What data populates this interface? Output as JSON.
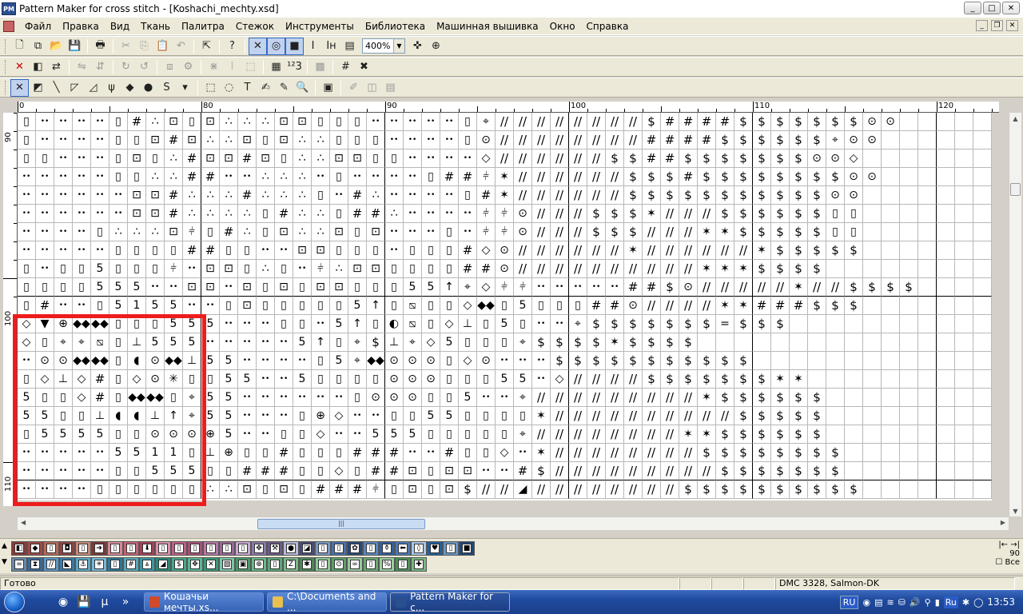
{
  "window": {
    "title": "Pattern Maker for cross stitch - [Koshachi_mechty.xsd]",
    "app_icon": "PM",
    "controls": [
      "_",
      "□",
      "✕"
    ]
  },
  "menu": [
    "Файл",
    "Правка",
    "Вид",
    "Ткань",
    "Палитра",
    "Стежок",
    "Инструменты",
    "Библиотека",
    "Машинная вышивка",
    "Окно",
    "Справка"
  ],
  "mdi_controls": [
    "_",
    "❐",
    "✕"
  ],
  "toolbars": {
    "row1": [
      "new-icon",
      "copy-doc-icon",
      "open-icon",
      "save-icon",
      "|",
      "print-icon",
      "|",
      "cut-icon",
      "copy-icon",
      "paste-icon",
      "undo-icon",
      "|",
      "import-icon",
      "|",
      "help-icon",
      "|",
      "full-stitch-view-icon",
      "symbol-view-icon",
      "color-view-icon",
      "text-view-icon",
      "backstitch-view-icon",
      "list-icon",
      "zoom-select",
      "fit-icon",
      "zoom-window-icon"
    ],
    "row2": [
      "delete-icon",
      "select-color-icon",
      "replace-color-icon",
      "|",
      "flip-h-icon",
      "flip-v-icon",
      "|",
      "rotate-cw-icon",
      "rotate-ccw-icon",
      "|",
      "mirror-icon",
      "gear-icon",
      "|",
      "grid-snap-icon",
      "sep-icon",
      "frame-icon",
      "|",
      "palette-icon",
      "numbers-icon",
      "|",
      "fill-icon",
      "|",
      "grid-icon",
      "cross-icon"
    ],
    "row3": [
      "full-stitch-icon",
      "half-cross-icon",
      "half-stitch-icon",
      "quarter-stitch-icon",
      "three-quarter-icon",
      "double-stitch-icon",
      "french-knot-icon",
      "bead-icon",
      "s-stitch-icon",
      "dropdown-icon",
      "|",
      "rect-select-icon",
      "lasso-icon",
      "text-tool-icon",
      "paint-icon",
      "eyedropper-icon",
      "magnifier-icon",
      "|",
      "library-icon",
      "|",
      "pencil-icon",
      "columns-icon",
      "list2-icon"
    ]
  },
  "zoom": {
    "value": "400%",
    "arrow": "▼"
  },
  "toolbar_glyphs": {
    "new-icon": "🗋",
    "copy-doc-icon": "⧉",
    "open-icon": "📂",
    "save-icon": "💾",
    "print-icon": "🖶",
    "cut-icon": "✂",
    "copy-icon": "⎘",
    "paste-icon": "📋",
    "undo-icon": "↶",
    "import-icon": "⇱",
    "help-icon": "?",
    "full-stitch-view-icon": "✕",
    "symbol-view-icon": "◎",
    "color-view-icon": "■",
    "text-view-icon": "I",
    "backstitch-view-icon": "Iн",
    "list-icon": "▤",
    "fit-icon": "✜",
    "zoom-window-icon": "⊕",
    "delete-icon": "✕",
    "select-color-icon": "◧",
    "replace-color-icon": "⇄",
    "flip-h-icon": "⇋",
    "flip-v-icon": "⇵",
    "rotate-cw-icon": "↻",
    "rotate-ccw-icon": "↺",
    "mirror-icon": "⧈",
    "gear-icon": "⚙",
    "grid-snap-icon": "⋇",
    "sep-icon": "⦚",
    "frame-icon": "⬚",
    "palette-icon": "▦",
    "numbers-icon": "¹²3",
    "fill-icon": "▩",
    "grid-icon": "#",
    "cross-icon": "✖",
    "full-stitch-icon": "✕",
    "half-cross-icon": "◩",
    "half-stitch-icon": "╲",
    "quarter-stitch-icon": "◸",
    "three-quarter-icon": "◿",
    "double-stitch-icon": "ψ",
    "french-knot-icon": "◆",
    "bead-icon": "●",
    "s-stitch-icon": "S",
    "dropdown-icon": "▾",
    "rect-select-icon": "⬚",
    "lasso-icon": "◌",
    "text-tool-icon": "T",
    "paint-icon": "✍",
    "eyedropper-icon": "✎",
    "magnifier-icon": "🔍",
    "library-icon": "▣",
    "pencil-icon": "✐",
    "columns-icon": "◫",
    "list2-icon": "▤"
  },
  "ruler": {
    "h_labels": [
      {
        "text": "0",
        "col": 0
      },
      {
        "text": "80",
        "col": 10
      },
      {
        "text": "90",
        "col": 20
      },
      {
        "text": "100",
        "col": 30
      },
      {
        "text": "110",
        "col": 40
      },
      {
        "text": "120",
        "col": 50
      }
    ],
    "v_labels": [
      {
        "text": "90",
        "row": 1
      },
      {
        "text": "100",
        "row": 11
      },
      {
        "text": "110",
        "row": 20
      }
    ]
  },
  "grid": {
    "cols": 53,
    "rows": 21,
    "symbols": {
      "a": "▯",
      "b": "••",
      "c": "#",
      "d": "∴",
      "e": "⊡",
      "f": "//",
      "g": "$",
      "h": "⊙",
      "i": "◇",
      "j": "✳",
      "k": "5",
      "l": "⫩",
      "m": "⌖",
      "n": "⊕",
      "o": "↑",
      "p": "⧅",
      "q": "◆◆",
      "r": "▼",
      "s": "⊥",
      "t": "◢",
      "u": "◐",
      "v": "=",
      "w": "1",
      "x": "◖",
      "y": "♦",
      "z": "✶",
      "0": " "
    },
    "rows_data": [
      "abbbbacdeaedddeeaaabbbbbamffffffffgccccggggggghh",
      "abbbbaaeceddeaeddaaabbbbahffffffffccccggggggmhh",
      "aabbbaeadceeceaddeeaabbbbiffffffggccggggggghhi",
      "bbbbbaaddccbbdddbabbbbacclzffffffgggcgggggggghh",
      "bbbbbbeecdddcdddabcdbbbbaczffffffggggggggggghh",
      "bbbbbbeecddddacddaccdbbbbllhfffgggzfffggggggaa",
      "bbbbadddelacdaeddeaebbbabllhfffgggfffzzgggggaa",
      "bbbbbaaaaccaabbeeaaabaaacihffffffzffffffzggggg",
      "abaakaaalbeeadabldeeaaaacchffffffffffzzzgggg",
      "aaaakkkbbeebeaeaeeaaakkomillbbbbbccghfffffzffgggg",
      "acbbakwkkbbaeaaaaakoapaaiqakaaacchffffzzcccggg",
      "irnqqaaakkkbbbaabkoaupaisakabbmgggggggvggg",
      "iammpaskkkbbbbbkoamgsmikaaamggggzgggg",
      "bhhqqaxhqskkbbbbakmqhhhaihbbbggggggggggg",
      "aisicaihjaakkbbkaaaahhhaaakkbiffffgggggggzz",
      "kaaicaqqamkkbbbbbbahhhaakbbmfffffffffzgggggg",
      "kkaasxxsomkkbbbanibbaakkaaaazffffffffffggggg",
      "akkkkaahhhnkbbaaibbkkkaaaaamffffffffzzgggggg",
      "bbbbbkkwwasnaacaaacccbbcaaibzffffffffgggggggg",
      "bbbbbaakkkaacccaaiacceaeebbcgfffffffffggggggg",
      "bbbbaaaaaaddeaeaccclaeaegfftffffffffgggggggggg"
    ]
  },
  "palette": {
    "row1": [
      {
        "color": "#8a3a3a",
        "sym": "◧"
      },
      {
        "color": "#a04848",
        "sym": "◆"
      },
      {
        "color": "#b86b5a",
        "sym": "▯"
      },
      {
        "color": "#8b4545",
        "sym": "◘"
      },
      {
        "color": "#c88a78",
        "sym": "▯"
      },
      {
        "color": "#7a3a3a",
        "sym": "➜"
      },
      {
        "color": "#d88a98",
        "sym": "▯"
      },
      {
        "color": "#c86478",
        "sym": "▯"
      },
      {
        "color": "#a84058",
        "sym": "⬇"
      },
      {
        "color": "#d890a8",
        "sym": "▯"
      },
      {
        "color": "#c06088",
        "sym": "▯"
      },
      {
        "color": "#a85078",
        "sym": "▯"
      },
      {
        "color": "#b878a8",
        "sym": "▯"
      },
      {
        "color": "#9a6898",
        "sym": "▯"
      },
      {
        "color": "#c8a8d0",
        "sym": "▯"
      },
      {
        "color": "#8a78a8",
        "sym": "✥"
      },
      {
        "color": "#6a5a88",
        "sym": "⚒"
      },
      {
        "color": "#b8b8d8",
        "sym": "●"
      },
      {
        "color": "#4a4a78",
        "sym": "◪"
      },
      {
        "color": "#7898c8",
        "sym": "▯"
      },
      {
        "color": "#4870b0",
        "sym": "▯"
      },
      {
        "color": "#2a4878",
        "sym": "✿"
      },
      {
        "color": "#5888c0",
        "sym": "▯"
      },
      {
        "color": "#3060a0",
        "sym": "⚱"
      },
      {
        "color": "#4878b8",
        "sym": "⬅"
      },
      {
        "color": "#a8c8e8",
        "sym": "◊"
      },
      {
        "color": "#2060a0",
        "sym": "♥"
      },
      {
        "color": "#6898c8",
        "sym": "▯"
      },
      {
        "color": "#204878",
        "sym": "■"
      }
    ],
    "row2": [
      {
        "color": "#6a8aa8",
        "sym": "="
      },
      {
        "color": "#3a6a98",
        "sym": "⧗"
      },
      {
        "color": "#5a98c8",
        "sym": "//"
      },
      {
        "color": "#3a7aa8",
        "sym": "◣"
      },
      {
        "color": "#5aa8c8",
        "sym": "⚓"
      },
      {
        "color": "#78b8d8",
        "sym": "✳"
      },
      {
        "color": "#2a7898",
        "sym": "▯"
      },
      {
        "color": "#58a8b8",
        "sym": "#"
      },
      {
        "color": "#3898a8",
        "sym": "⩓"
      },
      {
        "color": "#2a8878",
        "sym": "◢"
      },
      {
        "color": "#48a888",
        "sym": "$"
      },
      {
        "color": "#58b898",
        "sym": "✥"
      },
      {
        "color": "#3a9878",
        "sym": "✕"
      },
      {
        "color": "#78c8a8",
        "sym": "▧"
      },
      {
        "color": "#489868",
        "sym": "▣"
      },
      {
        "color": "#68b888",
        "sym": "⊕"
      },
      {
        "color": "#58a878",
        "sym": "▯"
      },
      {
        "color": "#78b888",
        "sym": "Z"
      },
      {
        "color": "#4a8858",
        "sym": "✱"
      },
      {
        "color": "#88c898",
        "sym": "▯"
      },
      {
        "color": "#58a068",
        "sym": "⊙"
      },
      {
        "color": "#98c8a0",
        "sym": "∞"
      },
      {
        "color": "#68a870",
        "sym": "▯"
      },
      {
        "color": "#98d0a0",
        "sym": "%"
      },
      {
        "color": "#4a9058",
        "sym": "▯"
      },
      {
        "color": "#78b880",
        "sym": "✚"
      }
    ],
    "right_value": "90",
    "right_arrows": "|← →|",
    "checkbox_label": "Все"
  },
  "status": {
    "ready": "Готово",
    "thread": "DMC  3328, Salmon-DK"
  },
  "taskbar": {
    "tasks": [
      {
        "label": "Кошачьи мечты.xs...",
        "color": "#d04a2a",
        "active": false
      },
      {
        "label": "C:\\Documents and ...",
        "color": "#e8c050",
        "active": false
      },
      {
        "label": "Pattern Maker for c...",
        "color": "#2a4f8f",
        "active": true
      }
    ],
    "quicklaunch": [
      "chrome-icon",
      "floppy-icon",
      "torrent-icon",
      "more-icon"
    ],
    "ql_glyphs": {
      "chrome-icon": "◉",
      "floppy-icon": "💾",
      "torrent-icon": "µ",
      "more-icon": "»"
    },
    "tray": {
      "lang": "RU",
      "lang2": "Ru",
      "time": "13:53"
    }
  }
}
